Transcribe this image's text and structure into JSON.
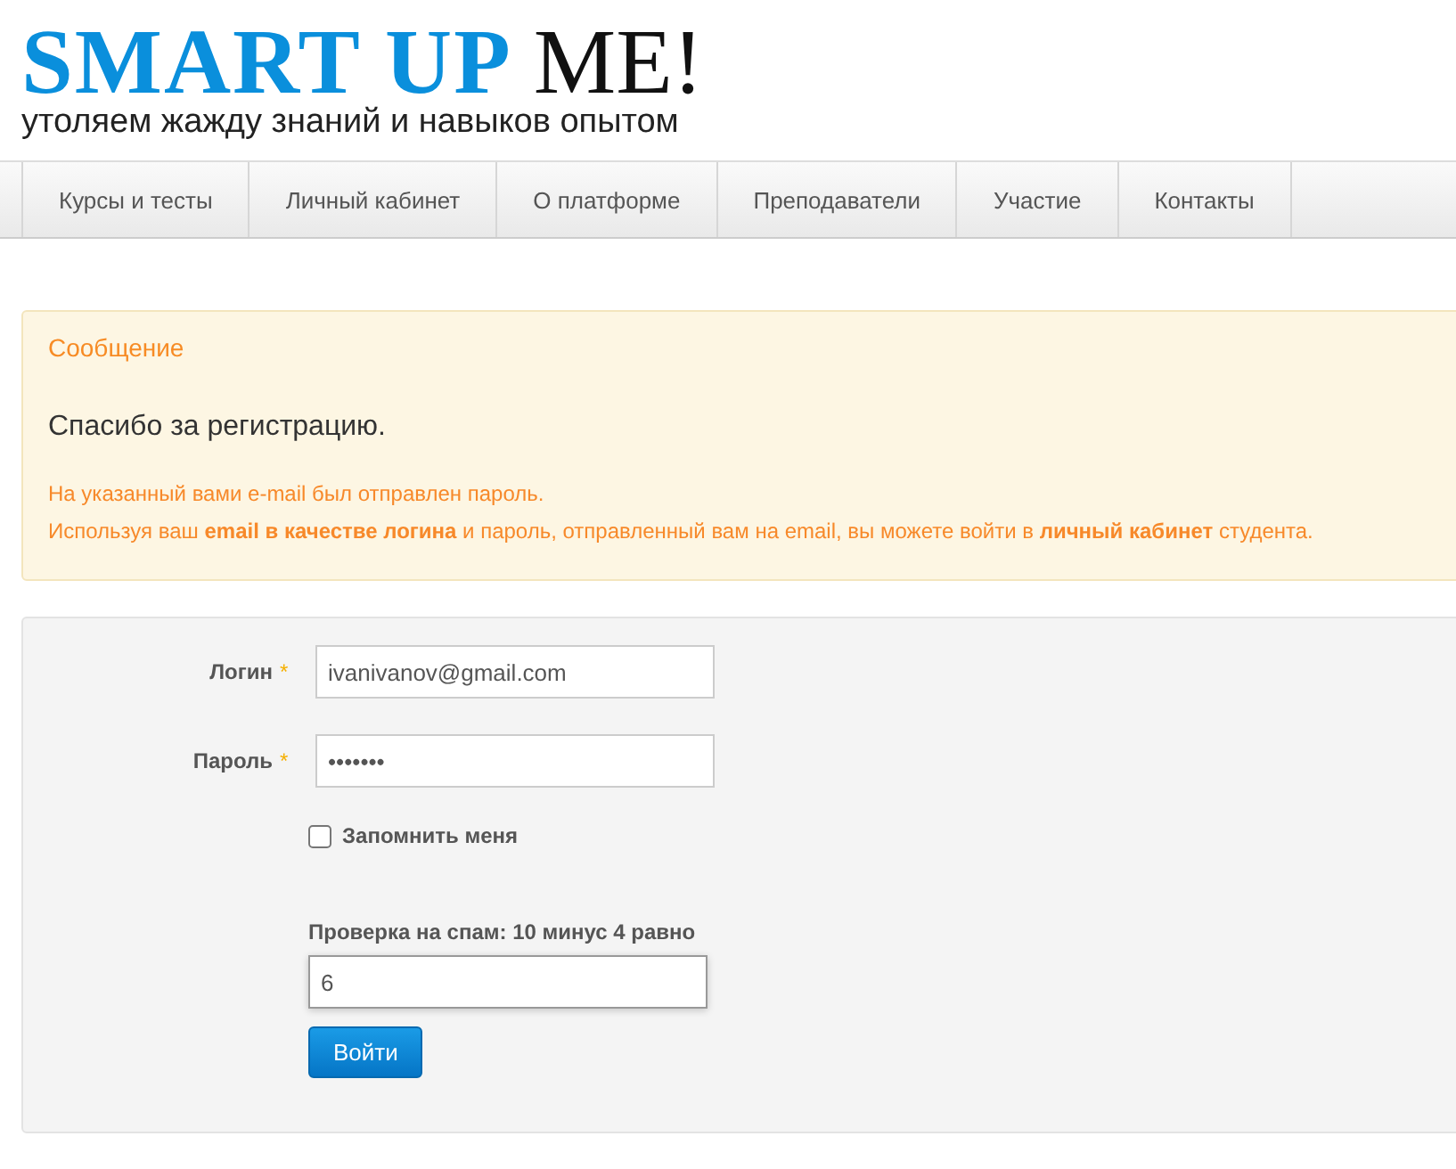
{
  "logo": {
    "brand": "SMART UP",
    "accent": "ME!",
    "tagline": "утоляем жажду знаний и навыков опытом"
  },
  "nav": [
    {
      "label": "Курсы и тесты"
    },
    {
      "label": "Личный кабинет"
    },
    {
      "label": "О платформе"
    },
    {
      "label": "Преподаватели"
    },
    {
      "label": "Участие"
    },
    {
      "label": "Контакты"
    }
  ],
  "message": {
    "title": "Сообщение",
    "heading": "Спасибо за регистрацию.",
    "lines": [
      "На указанный вами e-mail был отправлен пароль.",
      "Используя ваш **email в качестве логина** и пароль, отправленный вам на email, вы можете войти в **личный кабинет** студента."
    ]
  },
  "form": {
    "fields": [
      {
        "label": "Логин",
        "mark": "*",
        "value": "ivanivanov@gmail.com"
      },
      {
        "label": "Пароль",
        "mark": "*",
        "value": "•••••••"
      }
    ],
    "remember": {
      "label": "Запомнить меня",
      "checked": false
    },
    "captcha": {
      "label": "Проверка на спам: 10 минус 4 равно",
      "value": "6"
    },
    "submit": "Войти"
  }
}
